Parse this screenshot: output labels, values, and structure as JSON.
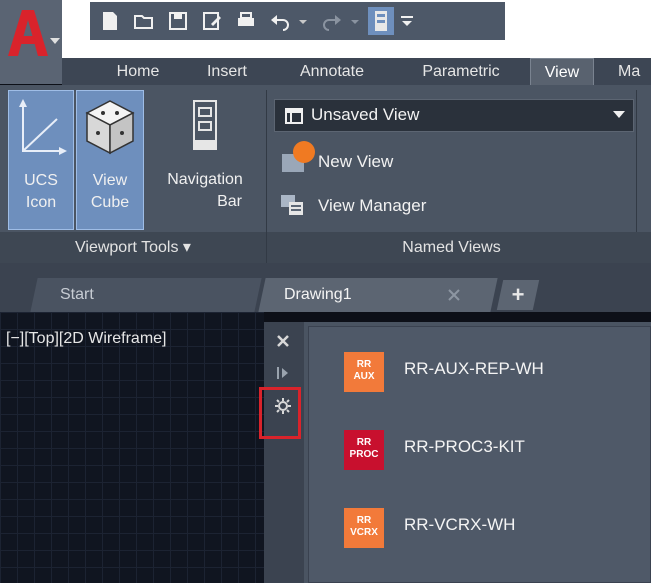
{
  "ribbon_tabs": [
    {
      "label": "Home"
    },
    {
      "label": "Insert"
    },
    {
      "label": "Annotate"
    },
    {
      "label": "Parametric"
    },
    {
      "label": "View",
      "active": true
    },
    {
      "label": "Ma"
    }
  ],
  "viewport_tools": {
    "ucs_icon": {
      "line1": "UCS",
      "line2": "Icon"
    },
    "view_cube": {
      "line1": "View",
      "line2": "Cube"
    },
    "navigation_bar": {
      "line1": "Navigation",
      "line2": "Bar"
    },
    "panel_label": "Viewport Tools ▾"
  },
  "named_views": {
    "dropdown_value": "Unsaved View",
    "new_view": "New View",
    "view_manager": "View Manager",
    "panel_label": "Named Views"
  },
  "file_tabs": [
    {
      "label": "Start"
    },
    {
      "label": "Drawing1",
      "active": true
    }
  ],
  "new_tab_symbol": "+",
  "viewport_label": "[−][Top][2D Wireframe]",
  "tool_palette": {
    "items": [
      {
        "name": "RR-AUX-REP-WH",
        "icon_text_top": "RR",
        "icon_text_bottom": "AUX",
        "icon_color": "#f27a3a"
      },
      {
        "name": "RR-PROC3-KIT",
        "icon_text_top": "RR",
        "icon_text_bottom": "PROC",
        "icon_color": "#c8102e"
      },
      {
        "name": "RR-VCRX-WH",
        "icon_text_top": "RR",
        "icon_text_bottom": "VCRX",
        "icon_color": "#f27a3a"
      }
    ]
  },
  "colors": {
    "accent_red": "#d9232b",
    "ribbon_bg": "#4b5563",
    "selected_button": "#6e8fbd"
  }
}
